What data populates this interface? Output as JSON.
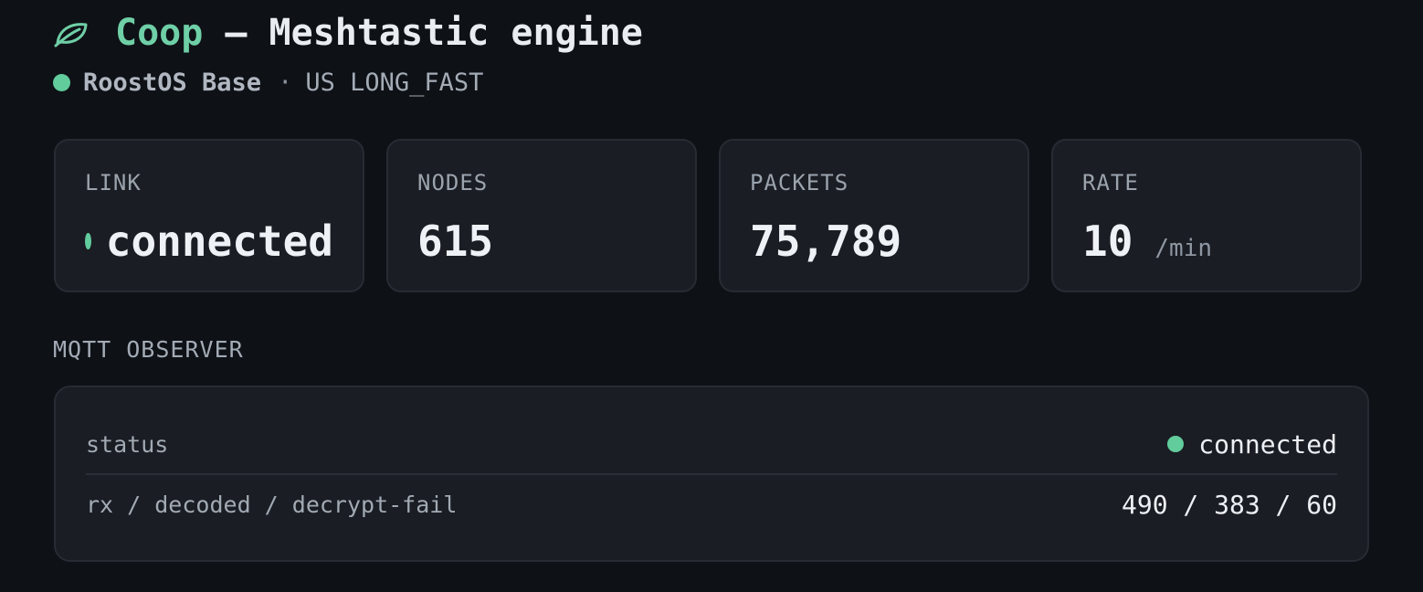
{
  "header": {
    "icon": "leaf-icon",
    "app_name": "Coop",
    "title_rest": "— Meshtastic engine"
  },
  "subtitle": {
    "status_color": "#62cc9d",
    "device_name": "RoostOS Base",
    "separator": "·",
    "region": "US LONG_FAST"
  },
  "stats": [
    {
      "label": "LINK",
      "value": "connected",
      "unit": "",
      "status_color": "#62cc9d"
    },
    {
      "label": "NODES",
      "value": "615",
      "unit": ""
    },
    {
      "label": "PACKETS",
      "value": "75,789",
      "unit": ""
    },
    {
      "label": "RATE",
      "value": "10",
      "unit": "/min"
    }
  ],
  "mqtt": {
    "section_label": "MQTT OBSERVER",
    "rows": [
      {
        "key": "status",
        "value": "connected",
        "status_color": "#62cc9d"
      },
      {
        "key": "rx / decoded / decrypt-fail",
        "value": "490 / 383 / 60"
      }
    ]
  },
  "colors": {
    "accent": "#6fcfa6",
    "background": "#0e1116",
    "card": "#1a1d23",
    "status_ok": "#62cc9d"
  }
}
